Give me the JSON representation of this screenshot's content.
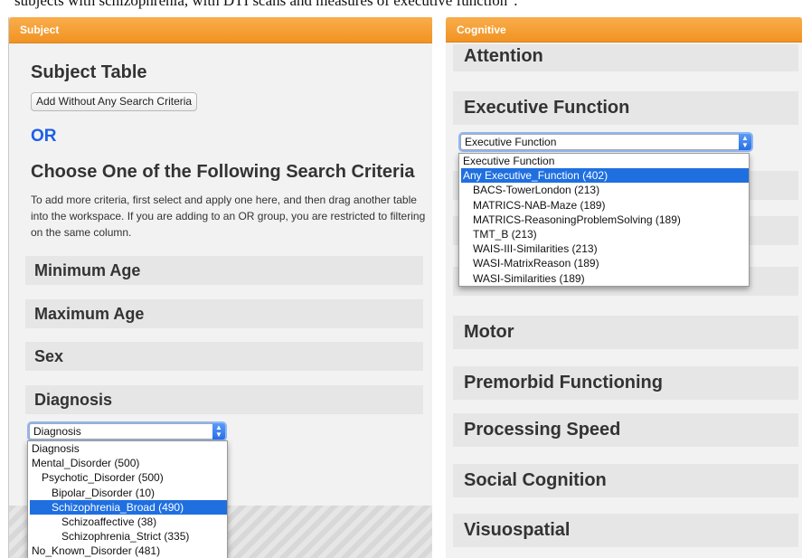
{
  "caption": "subjects with schizophrenia, with DTI scans and measures of executive function\".",
  "subject_panel": {
    "header": "Subject",
    "title": "Subject Table",
    "add_button": "Add Without Any Search Criteria",
    "or_label": "OR",
    "choose_title": "Choose One of the Following Search Criteria",
    "instructions": "To add more criteria, first select and apply one here, and then drag another table into the workspace. If you are adding to an OR group, you are restricted to filtering on the same column.",
    "sections": [
      "Minimum Age",
      "Maximum Age",
      "Sex",
      "Diagnosis"
    ],
    "diagnosis_select": {
      "value": "Diagnosis",
      "options": [
        {
          "label": "Diagnosis",
          "indent": 0,
          "selected": false
        },
        {
          "label": "Mental_Disorder (500)",
          "indent": 0,
          "selected": false
        },
        {
          "label": "Psychotic_Disorder (500)",
          "indent": 1,
          "selected": false
        },
        {
          "label": "Bipolar_Disorder (10)",
          "indent": 2,
          "selected": false
        },
        {
          "label": "Schizophrenia_Broad (490)",
          "indent": 2,
          "selected": true
        },
        {
          "label": "Schizoaffective (38)",
          "indent": 3,
          "selected": false
        },
        {
          "label": "Schizophrenia_Strict (335)",
          "indent": 3,
          "selected": false
        },
        {
          "label": "No_Known_Disorder (481)",
          "indent": 0,
          "selected": false
        }
      ]
    }
  },
  "cognitive_panel": {
    "header": "Cognitive",
    "sections": [
      "Attention",
      "Executive Function",
      "Motor",
      "Premorbid Functioning",
      "Processing Speed",
      "Social Cognition",
      "Visuospatial"
    ],
    "executive_select": {
      "value": "Executive Function",
      "options": [
        {
          "label": "Executive Function",
          "indent": 0,
          "selected": false
        },
        {
          "label": "Any Executive_Function (402)",
          "indent": 0,
          "selected": true
        },
        {
          "label": "BACS-TowerLondon (213)",
          "indent": 1,
          "selected": false
        },
        {
          "label": "MATRICS-NAB-Maze (189)",
          "indent": 1,
          "selected": false
        },
        {
          "label": "MATRICS-ReasoningProblemSolving (189)",
          "indent": 1,
          "selected": false
        },
        {
          "label": "TMT_B (213)",
          "indent": 1,
          "selected": false
        },
        {
          "label": "WAIS-III-Similarities (213)",
          "indent": 1,
          "selected": false
        },
        {
          "label": "WASI-MatrixReason (189)",
          "indent": 1,
          "selected": false
        },
        {
          "label": "WASI-Similarities (189)",
          "indent": 1,
          "selected": false
        }
      ]
    }
  },
  "colors": {
    "header_orange": "#f19322",
    "or_blue": "#1b5fe6",
    "selection_blue": "#1f6fe0"
  },
  "icons": {
    "select_arrow": "updown-chevron-icon"
  }
}
